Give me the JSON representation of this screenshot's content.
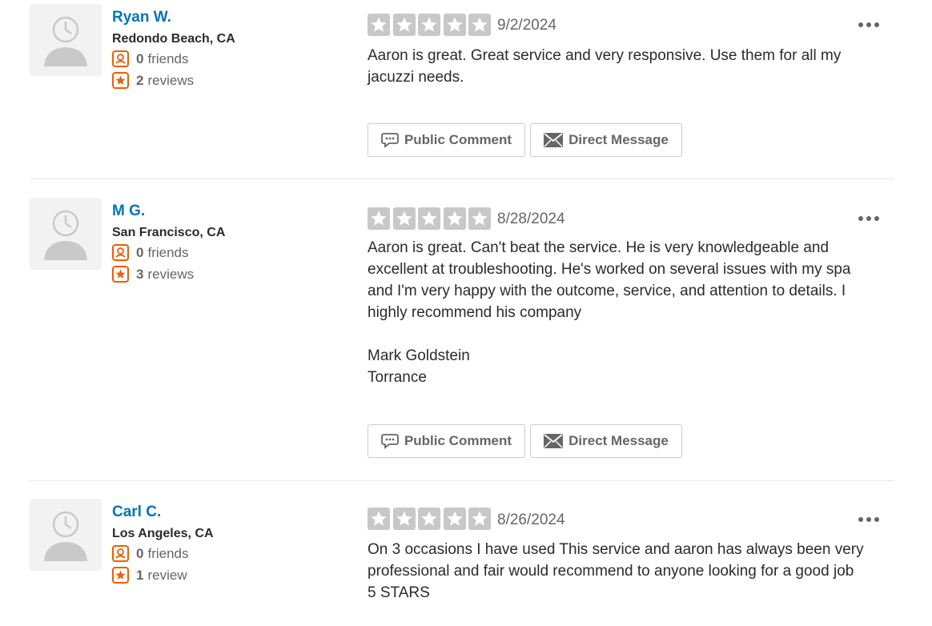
{
  "colors": {
    "name_link": "#0073bb",
    "star_empty": "#c8c8c8",
    "stat_icon": "#f15c00",
    "text": "#2b2b2b",
    "muted": "#666666"
  },
  "reviews": [
    {
      "user_name": "Ryan W.",
      "location": "Redondo Beach, CA",
      "friends_count": "0",
      "friends_label": "friends",
      "reviews_count": "2",
      "reviews_label": "reviews",
      "rating": 0,
      "date": "9/2/2024",
      "text_lines": [
        "Aaron is great. Great service and very responsive. Use them for all my jacuzzi needs."
      ],
      "public_comment_label": "Public Comment",
      "direct_message_label": "Direct Message"
    },
    {
      "user_name": "M G.",
      "location": "San Francisco, CA",
      "friends_count": "0",
      "friends_label": "friends",
      "reviews_count": "3",
      "reviews_label": "reviews",
      "rating": 0,
      "date": "8/28/2024",
      "text_lines": [
        "Aaron is great.  Can't beat the service. He is very knowledgeable and excellent at troubleshooting.  He's worked on several issues with my spa and I'm very happy with the outcome,  service, and attention to details.   I highly recommend his company",
        "",
        "Mark Goldstein",
        "Torrance"
      ],
      "public_comment_label": "Public Comment",
      "direct_message_label": "Direct Message"
    },
    {
      "user_name": "Carl C.",
      "location": "Los Angeles, CA",
      "friends_count": "0",
      "friends_label": "friends",
      "reviews_count": "1",
      "reviews_label": "review",
      "rating": 0,
      "date": "8/26/2024",
      "text_lines": [
        "On 3 occasions I have used This service and aaron has always been very professional and fair would recommend to anyone looking for a good job",
        "5 STARS"
      ]
    }
  ]
}
